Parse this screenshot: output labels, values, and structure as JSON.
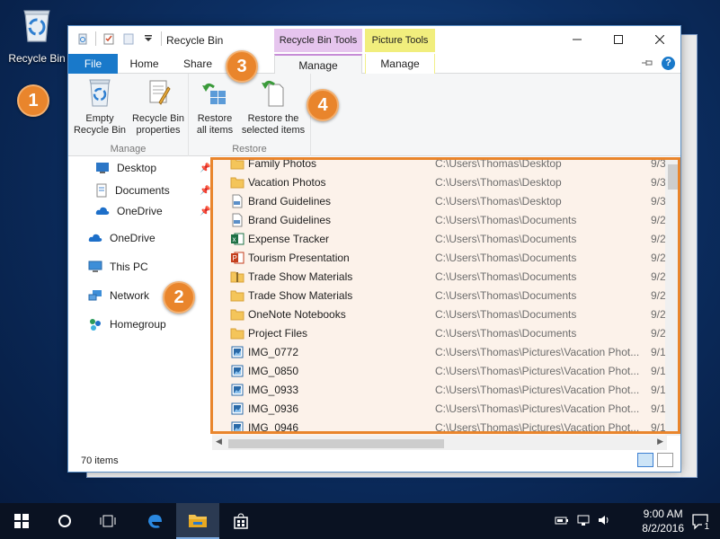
{
  "desktop": {
    "icon_label": "Recycle Bin"
  },
  "callouts": [
    "1",
    "2",
    "3",
    "4"
  ],
  "window": {
    "title": "Recycle Bin",
    "context_tabs": {
      "recycle_bin_tools": "Recycle Bin Tools",
      "picture_tools": "Picture Tools"
    },
    "tabs": {
      "file": "File",
      "home": "Home",
      "share": "Share",
      "manage_rb": "Manage",
      "manage_pic": "Manage"
    },
    "help": "?",
    "ribbon": {
      "groups": [
        {
          "label": "Manage",
          "buttons": [
            "Empty\nRecycle Bin",
            "Recycle Bin\nproperties"
          ]
        },
        {
          "label": "Restore",
          "buttons": [
            "Restore\nall items",
            "Restore the\nselected items"
          ]
        }
      ],
      "empty_bin": "Empty Recycle Bin",
      "properties": "Recycle Bin properties",
      "restore_all": "Restore all items",
      "restore_selected": "Restore the selected items",
      "group_manage": "Manage",
      "group_restore": "Restore"
    },
    "nav": {
      "desktop": "Desktop",
      "documents": "Documents",
      "onedrive_quick": "OneDrive",
      "onedrive": "OneDrive",
      "this_pc": "This PC",
      "network": "Network",
      "homegroup": "Homegroup"
    },
    "files": [
      {
        "name": "Family Photos",
        "path": "C:\\Users\\Thomas\\Desktop",
        "date": "9/3",
        "icon": "folder-icon"
      },
      {
        "name": "Vacation Photos",
        "path": "C:\\Users\\Thomas\\Desktop",
        "date": "9/3",
        "icon": "folder-icon"
      },
      {
        "name": "Brand Guidelines",
        "path": "C:\\Users\\Thomas\\Desktop",
        "date": "9/3",
        "icon": "pdf-icon"
      },
      {
        "name": "Brand Guidelines",
        "path": "C:\\Users\\Thomas\\Documents",
        "date": "9/2",
        "icon": "pdf-icon"
      },
      {
        "name": "Expense Tracker",
        "path": "C:\\Users\\Thomas\\Documents",
        "date": "9/2",
        "icon": "excel-icon"
      },
      {
        "name": "Tourism Presentation",
        "path": "C:\\Users\\Thomas\\Documents",
        "date": "9/2",
        "icon": "powerpoint-icon"
      },
      {
        "name": "Trade Show Materials",
        "path": "C:\\Users\\Thomas\\Documents",
        "date": "9/2",
        "icon": "zip-folder-icon"
      },
      {
        "name": "Trade Show Materials",
        "path": "C:\\Users\\Thomas\\Documents",
        "date": "9/2",
        "icon": "folder-icon"
      },
      {
        "name": "OneNote Notebooks",
        "path": "C:\\Users\\Thomas\\Documents",
        "date": "9/2",
        "icon": "folder-icon"
      },
      {
        "name": "Project Files",
        "path": "C:\\Users\\Thomas\\Documents",
        "date": "9/2",
        "icon": "folder-icon"
      },
      {
        "name": "IMG_0772",
        "path": "C:\\Users\\Thomas\\Pictures\\Vacation Phot...",
        "date": "9/1",
        "icon": "image-icon"
      },
      {
        "name": "IMG_0850",
        "path": "C:\\Users\\Thomas\\Pictures\\Vacation Phot...",
        "date": "9/1",
        "icon": "image-icon"
      },
      {
        "name": "IMG_0933",
        "path": "C:\\Users\\Thomas\\Pictures\\Vacation Phot...",
        "date": "9/1",
        "icon": "image-icon"
      },
      {
        "name": "IMG_0936",
        "path": "C:\\Users\\Thomas\\Pictures\\Vacation Phot...",
        "date": "9/1",
        "icon": "image-icon"
      },
      {
        "name": "IMG_0946",
        "path": "C:\\Users\\Thomas\\Pictures\\Vacation Phot...",
        "date": "9/1",
        "icon": "image-icon"
      }
    ],
    "status": {
      "count": "70 items"
    }
  },
  "taskbar": {
    "time": "9:00 AM",
    "date": "8/2/2016",
    "notification_count": "1"
  },
  "colors": {
    "accent": "#1979ca",
    "callout": "#e9852c",
    "selection": "#fcf2ea"
  }
}
